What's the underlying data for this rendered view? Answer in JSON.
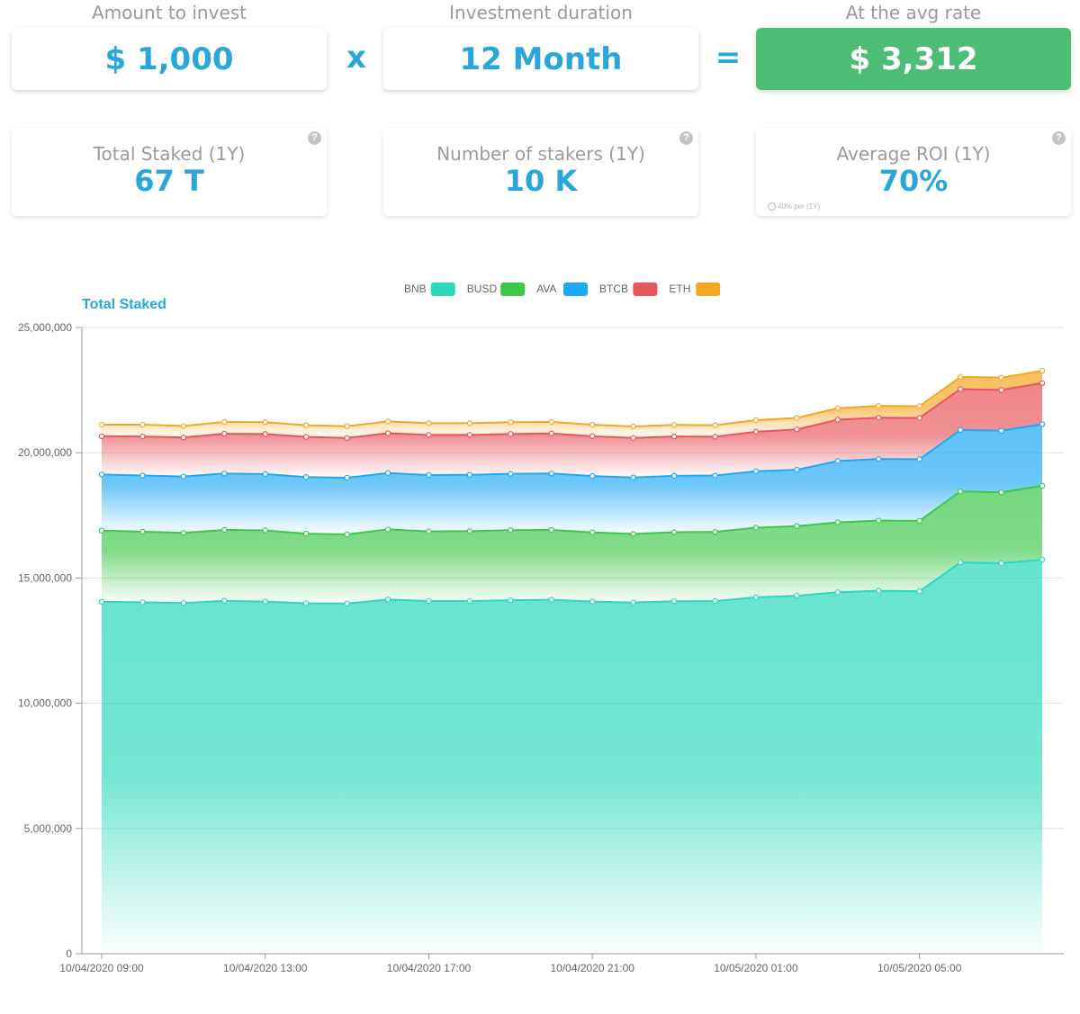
{
  "calculator": {
    "amount_label": "Amount to invest",
    "amount_value": "$ 1,000",
    "multiply_sign": "x",
    "duration_label": "Investment duration",
    "duration_value": "12 Month",
    "equals_sign": "=",
    "rate_label": "At the avg rate",
    "rate_value": "$ 3,312"
  },
  "stats": {
    "total_staked": {
      "label": "Total Staked (1Y)",
      "value": "67 T",
      "help": "?"
    },
    "stakers": {
      "label": "Number of stakers (1Y)",
      "value": "10 K",
      "help": "?"
    },
    "roi": {
      "label": "Average ROI (1Y)",
      "value": "70%",
      "help": "?",
      "note": "40% per (1Y)"
    }
  },
  "colors": {
    "accent": "#2aa7d9",
    "result_bg": "#4dbd74",
    "label_gray": "#9a9a9a"
  },
  "chart_data": {
    "type": "area",
    "stacked": true,
    "title": "Total Staked",
    "legend_position": "top-center",
    "grid": true,
    "ylim": [
      0,
      25000000
    ],
    "y_ticks": [
      "25,000,000",
      "20,000,000",
      "15,000,000",
      "10,000,000",
      "5,000,000",
      "0"
    ],
    "y_tick_values": [
      25000000,
      20000000,
      15000000,
      10000000,
      5000000,
      0
    ],
    "x_tick_labels": [
      "10/04/2020 09:00",
      "10/04/2020 13:00",
      "10/04/2020 17:00",
      "10/04/2020 21:00",
      "10/05/2020 01:00",
      "10/05/2020 05:00"
    ],
    "x_tick_indices": [
      0,
      4,
      8,
      12,
      16,
      20
    ],
    "x": [
      "09:00",
      "10:00",
      "11:00",
      "12:00",
      "13:00",
      "14:00",
      "15:00",
      "16:00",
      "17:00",
      "18:00",
      "19:00",
      "20:00",
      "21:00",
      "22:00",
      "23:00",
      "00:00",
      "01:00",
      "02:00",
      "03:00",
      "04:00",
      "05:00",
      "06:00",
      "07:00",
      "08:00"
    ],
    "series": [
      {
        "name": "BNB",
        "color": "#2ad9bb",
        "values": [
          14050000,
          14030000,
          14000000,
          14090000,
          14060000,
          13990000,
          13980000,
          14140000,
          14080000,
          14080000,
          14110000,
          14130000,
          14060000,
          14020000,
          14070000,
          14080000,
          14230000,
          14290000,
          14430000,
          14490000,
          14470000,
          15620000,
          15590000,
          15730000
        ]
      },
      {
        "name": "BUSD",
        "color": "#3dc84a",
        "values": [
          2840000,
          2820000,
          2800000,
          2830000,
          2840000,
          2780000,
          2760000,
          2800000,
          2780000,
          2790000,
          2800000,
          2790000,
          2760000,
          2740000,
          2760000,
          2760000,
          2780000,
          2780000,
          2790000,
          2800000,
          2810000,
          2840000,
          2830000,
          2950000
        ]
      },
      {
        "name": "AVA",
        "color": "#1ea8f5",
        "values": [
          2240000,
          2240000,
          2250000,
          2250000,
          2250000,
          2260000,
          2260000,
          2250000,
          2250000,
          2250000,
          2250000,
          2250000,
          2250000,
          2250000,
          2250000,
          2250000,
          2250000,
          2250000,
          2450000,
          2460000,
          2460000,
          2450000,
          2460000,
          2460000
        ]
      },
      {
        "name": "BTCB",
        "color": "#e8555b",
        "values": [
          1530000,
          1560000,
          1560000,
          1590000,
          1600000,
          1600000,
          1590000,
          1590000,
          1600000,
          1590000,
          1590000,
          1600000,
          1590000,
          1580000,
          1570000,
          1550000,
          1580000,
          1610000,
          1650000,
          1650000,
          1650000,
          1630000,
          1630000,
          1640000
        ]
      },
      {
        "name": "ETH",
        "color": "#f5a623",
        "values": [
          460000,
          470000,
          460000,
          470000,
          470000,
          470000,
          470000,
          470000,
          470000,
          470000,
          470000,
          460000,
          460000,
          460000,
          460000,
          460000,
          460000,
          460000,
          460000,
          470000,
          470000,
          490000,
          490000,
          490000
        ]
      }
    ]
  }
}
